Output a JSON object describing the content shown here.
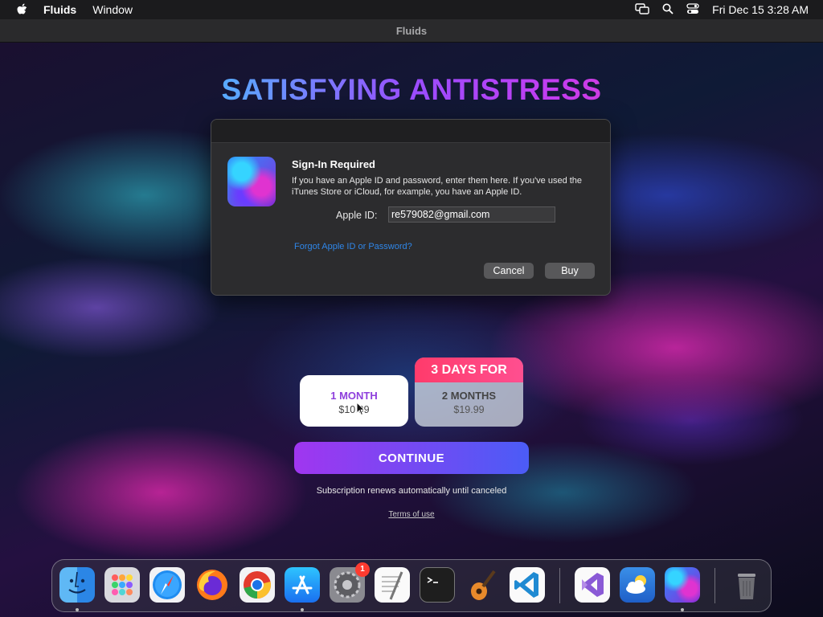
{
  "menubar": {
    "app_name": "Fluids",
    "menu_items": [
      "Window"
    ],
    "clock": "Fri Dec 15  3:28 AM"
  },
  "window": {
    "title": "Fluids"
  },
  "headline": "SATISFYING ANTISTRESS",
  "dialog": {
    "title": "Sign-In Required",
    "message": "If you have an Apple ID and password, enter them here. If you've used the iTunes Store or iCloud, for example, you have an Apple ID.",
    "field_label": "Apple ID:",
    "field_value": "re579082@gmail.com",
    "forgot_link": "Forgot Apple ID or Password?",
    "cancel_label": "Cancel",
    "buy_label": "Buy"
  },
  "plans": [
    {
      "name": "1 MONTH",
      "price": "$10.99"
    },
    {
      "badge": "3 DAYS FOR",
      "name": "2 MONTHS",
      "price": "$19.99"
    }
  ],
  "continue_label": "CONTINUE",
  "renew_note": "Subscription renews automatically until canceled",
  "terms_link": "Terms of use",
  "dock": {
    "items": [
      "finder",
      "launchpad",
      "safari",
      "firefox",
      "chrome",
      "app-store",
      "system-settings",
      "textedit",
      "terminal",
      "garageband",
      "vscode",
      "visual-studio",
      "weather",
      "fluids",
      "trash"
    ],
    "settings_badge": "1"
  },
  "colors": {
    "link": "#2f86e8",
    "continue_gradient": [
      "#a036f0",
      "#4b5cf6"
    ],
    "badge_pink": "#ff3b6b",
    "plan_purple": "#8e3fdc"
  }
}
